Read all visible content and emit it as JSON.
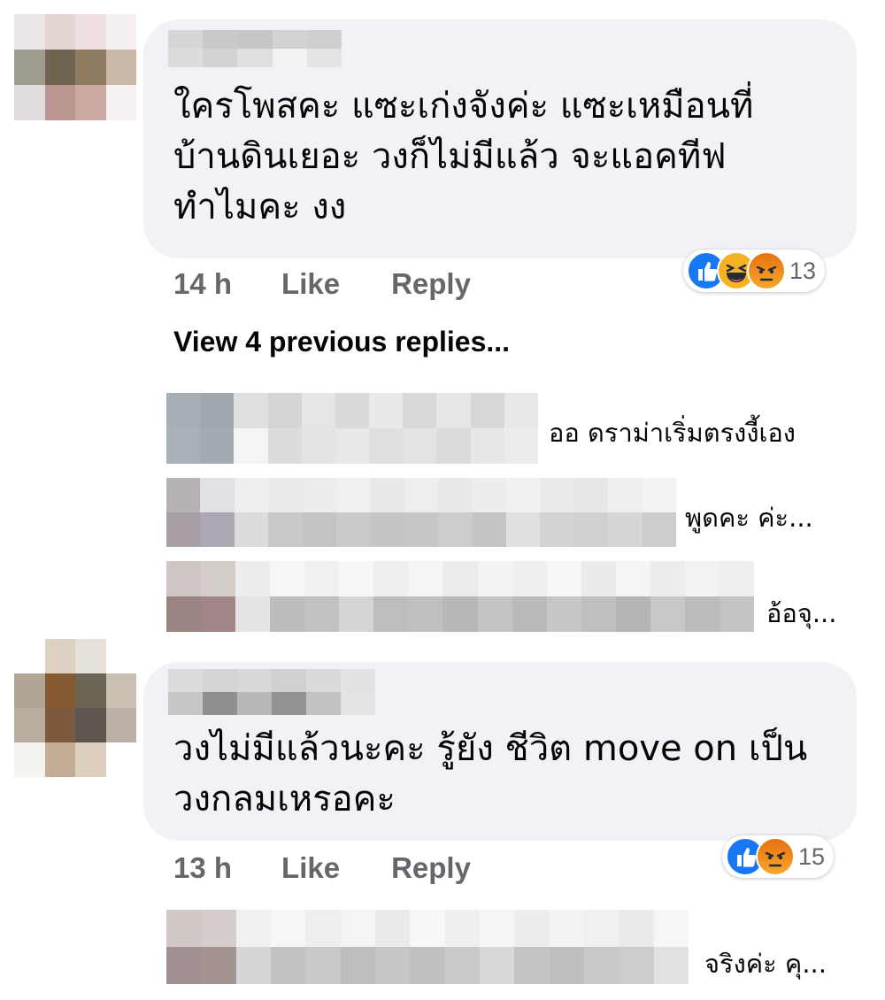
{
  "comments": [
    {
      "text": "ใครโพสคะ แซะเก่งจังค่ะ แซะเหมือนที่\nบ้านดินเยอะ วงก็ไม่มีแล้ว จะแอคทีฟ\nทำไมคะ งง",
      "time": "14 h",
      "like_label": "Like",
      "reply_label": "Reply",
      "reactions": [
        "like-icon",
        "haha-icon",
        "angry-icon"
      ],
      "reaction_count": "13"
    },
    {
      "text": "วงไม่มีแล้วนะคะ รู้ยัง ชีวิต move on เป็น\nวงกลมเหรอคะ",
      "time": "13 h",
      "like_label": "Like",
      "reply_label": "Reply",
      "reactions": [
        "like-icon",
        "angry-icon"
      ],
      "reaction_count": "15"
    }
  ],
  "view_previous_label": "View 4 previous replies...",
  "replies_1": [
    {
      "text": "ออ ดราม่าเริ่มตรงงี้เอง"
    },
    {
      "text": "พูดคะ ค่ะ..."
    },
    {
      "text": "อ้อจุ..."
    }
  ],
  "replies_2": [
    {
      "text": "จริงค่ะ คุ..."
    }
  ],
  "colors": {
    "bubble": "#f0f2f5",
    "meta_text": "#65676b",
    "like_blue": "#1877f2",
    "haha_yellow": "#f7b125",
    "angry_orange": "#e9710f"
  }
}
